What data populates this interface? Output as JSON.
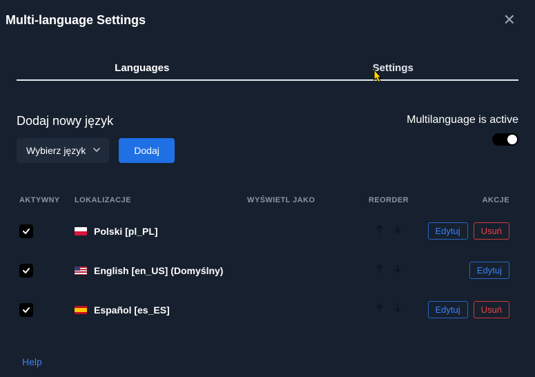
{
  "header": {
    "title": "Multi-language Settings"
  },
  "tabs": {
    "languages": "Languages",
    "settings": "Settings"
  },
  "add": {
    "title": "Dodaj nowy język",
    "select_label": "Wybierz język",
    "submit": "Dodaj"
  },
  "status": {
    "label": "Multilanguage is active",
    "active": true
  },
  "columns": {
    "active": "AKTYWNY",
    "locale": "LOKALIZACJE",
    "display_as": "WYŚWIETL JAKO",
    "reorder": "REORDER",
    "actions": "AKCJE"
  },
  "rows": [
    {
      "active": true,
      "flag": "pl",
      "label": "Polski [pl_PL]",
      "edit": "Edytuj",
      "del": "Usuń",
      "deletable": true
    },
    {
      "active": true,
      "flag": "us",
      "label": "English [en_US] (Domyślny)",
      "edit": "Edytuj",
      "del": "",
      "deletable": false
    },
    {
      "active": true,
      "flag": "es",
      "label": "Español [es_ES]",
      "edit": "Edytuj",
      "del": "Usuń",
      "deletable": true
    }
  ],
  "help": "Help"
}
